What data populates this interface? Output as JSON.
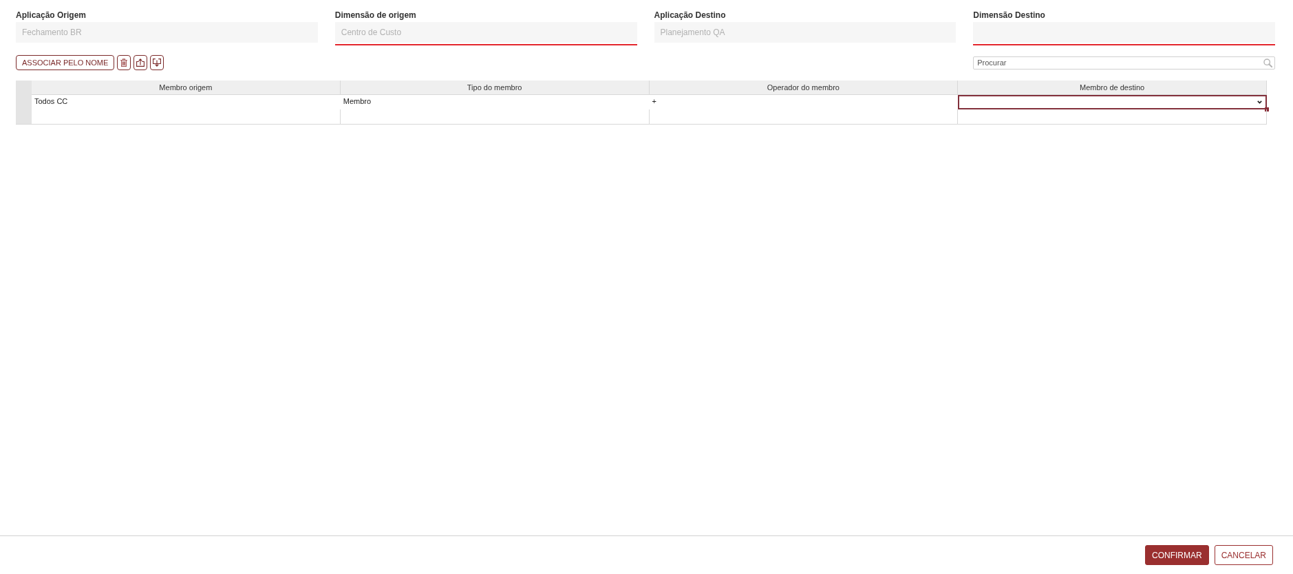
{
  "fields": [
    {
      "label": "Aplicação Origem",
      "value": "Fechamento BR",
      "invalid": false
    },
    {
      "label": "Dimensão de origem",
      "value": "Centro de Custo",
      "invalid": true
    },
    {
      "label": "Aplicação Destino",
      "value": "Planejamento QA",
      "invalid": false
    },
    {
      "label": "Dimensão Destino",
      "invalid": true
    }
  ],
  "toolbar": {
    "buttons": [
      {
        "kind": "text",
        "label": "ASSOCIAR PELO NOME"
      },
      {
        "kind": "trash"
      },
      {
        "kind": "upload"
      },
      {
        "kind": "download"
      }
    ]
  },
  "search": {
    "placeholder": "Procurar"
  },
  "table": {
    "columns": [
      "Membro origem",
      "Tipo do membro",
      "Operador do membro",
      "Membro de destino"
    ],
    "rows": [
      {
        "kind": "data",
        "cells": [
          {
            "kind": "text",
            "text": "Todos CC",
            "selected": false
          },
          {
            "kind": "text",
            "text": "Membro",
            "selected": false
          },
          {
            "kind": "text",
            "text": "+",
            "selected": false
          },
          {
            "kind": "dropdown",
            "selected": true
          }
        ]
      },
      {
        "kind": "blank"
      }
    ]
  },
  "footer": {
    "buttons": [
      {
        "kind": "primary",
        "label": "CONFIRMAR"
      },
      {
        "kind": "secondary",
        "label": "CANCELAR"
      }
    ]
  }
}
